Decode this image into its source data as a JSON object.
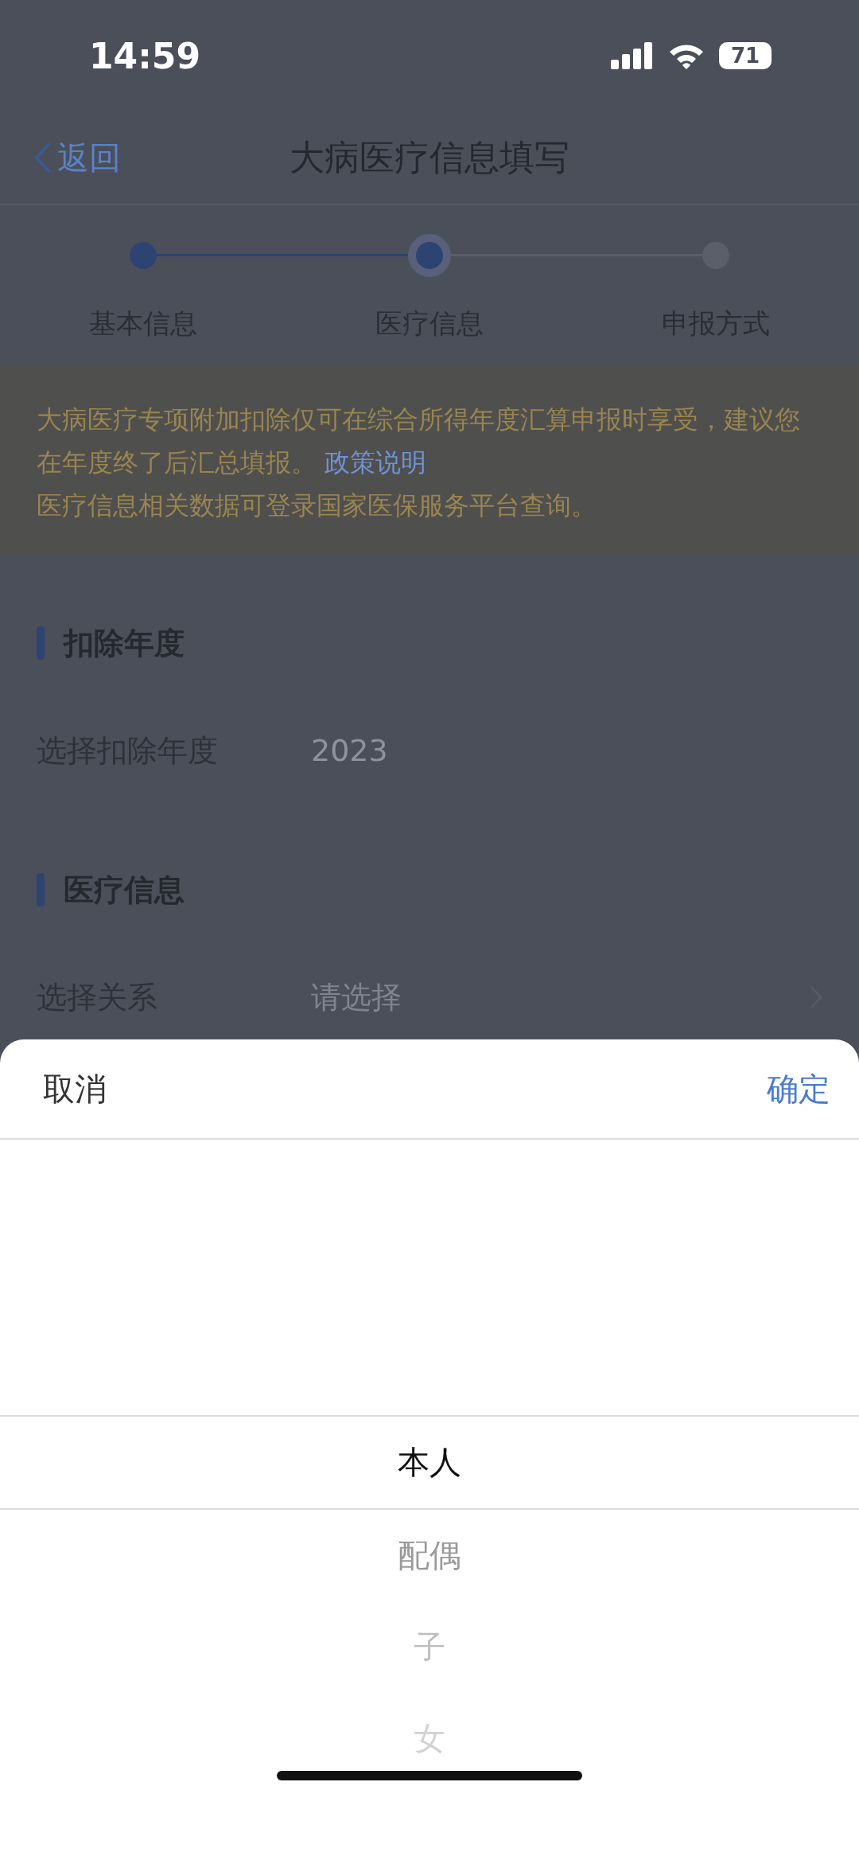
{
  "status_bar": {
    "time": "14:59",
    "battery": "71"
  },
  "nav": {
    "back": "返回",
    "title": "大病医疗信息填写"
  },
  "steps": [
    {
      "label": "基本信息",
      "done": true,
      "current": false
    },
    {
      "label": "医疗信息",
      "done": true,
      "current": true
    },
    {
      "label": "申报方式",
      "done": false,
      "current": false
    }
  ],
  "notice": {
    "text": "大病医疗专项附加扣除仅可在综合所得年度汇算申报时享受，建议您在年度终了后汇总填报。",
    "link": "政策说明",
    "note": "医疗信息相关数据可登录国家医保服务平台查询。"
  },
  "sections": [
    {
      "title": "扣除年度",
      "rows": [
        {
          "label": "选择扣除年度",
          "value": "2023",
          "chevron": false
        }
      ]
    },
    {
      "title": "医疗信息",
      "rows": [
        {
          "label": "选择关系",
          "placeholder": "请选择",
          "chevron": true
        }
      ]
    }
  ],
  "sheet": {
    "cancel": "取消",
    "confirm": "确定",
    "options": [
      {
        "label": "本人",
        "selected": true
      },
      {
        "label": "配偶",
        "selected": false
      },
      {
        "label": "子",
        "selected": false
      },
      {
        "label": "女",
        "selected": false
      }
    ]
  }
}
